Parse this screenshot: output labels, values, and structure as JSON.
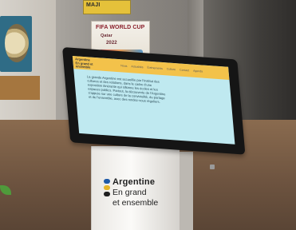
{
  "poster": {
    "brand": "MAJI",
    "headline": "FIFA WORLD CUP",
    "subline": "Qatar",
    "year": "2022"
  },
  "kiosk": {
    "screen_nav_brand": "Argentine En grand et ensemble",
    "screen_nav_links": [
      "Nous",
      "Actualités",
      "Évènements",
      "Culture",
      "Contact",
      "Agenda"
    ],
    "screen_paragraph": "La grande Argentine est accueillie par l'Institut des cultures et des relations, dans le cadre d'une exposition itinérante qui sillonne les écoles et les espaces publics. Partout, la découverte de l'Argentine s'appuie sur une culture de la convivialité, du partage et de l'ensemble, avec des rendez-vous réguliers."
  },
  "stand_logo": {
    "line1": "Argentine",
    "line2": "En grand",
    "line3": "et ensemble",
    "stripe_colors": [
      "#1f5aa8",
      "#e5b52a",
      "#1f1f1f"
    ]
  }
}
